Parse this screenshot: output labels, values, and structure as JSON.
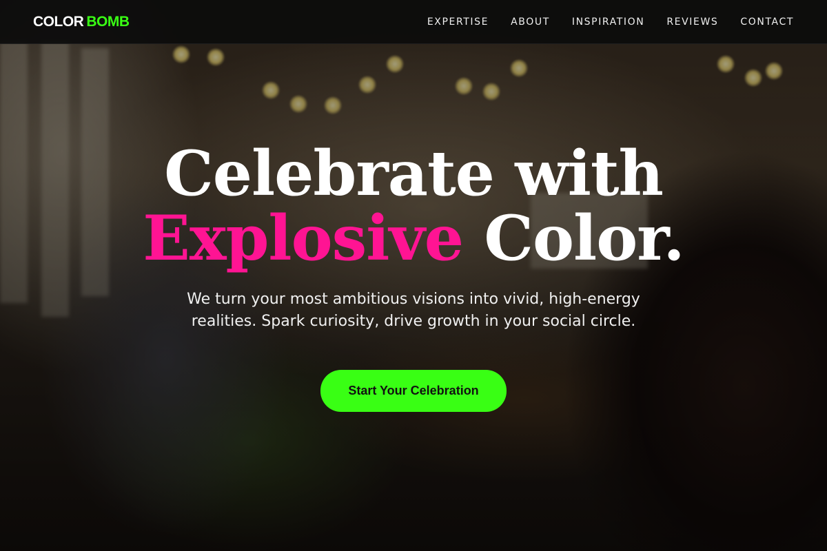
{
  "nav": {
    "logo": {
      "part1": "COLOR",
      "part2": "BOMB"
    },
    "links": [
      "EXPERTISE",
      "ABOUT",
      "INSPIRATION",
      "REVIEWS",
      "CONTACT"
    ]
  },
  "hero": {
    "headline_line1": "Celebrate with",
    "headline_highlight": "Explosive",
    "headline_rest": " Color.",
    "subtitle": "We turn your most ambitious visions into vivid, high-energy realities. Spark curiosity, drive growth in your social circle.",
    "cta_label": "Start Your Celebration"
  },
  "colors": {
    "accent_green": "#39ff14",
    "accent_pink": "#ff1493",
    "navbar_bg": "#0c0c0c"
  }
}
